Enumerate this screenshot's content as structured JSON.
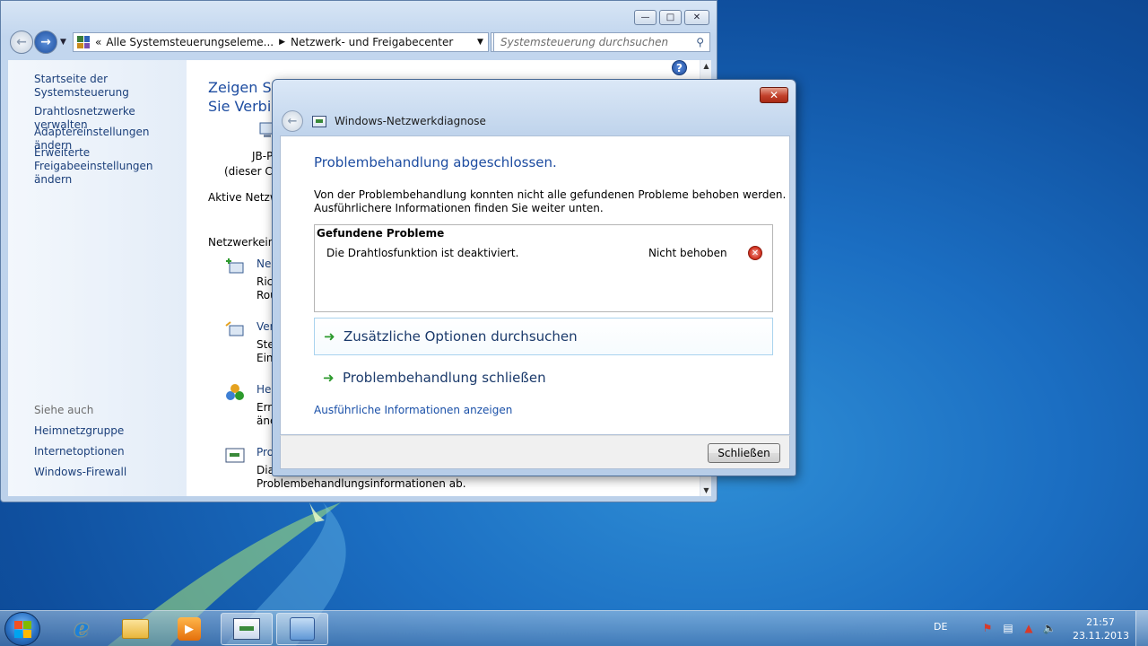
{
  "control_panel": {
    "breadcrumb": {
      "overflow": "«",
      "item1": "Alle Systemsteuerungseleme...",
      "item2": "Netzwerk- und Freigabecenter"
    },
    "search_placeholder": "Systemsteuerung durchsuchen",
    "sidebar": {
      "home": "Startseite der Systemsteuerung",
      "links": [
        "Drahtlosnetzwerke verwalten",
        "Adaptereinstellungen ändern",
        "Erweiterte",
        "Freigabeeinstellungen ändern"
      ],
      "see_also_heading": "Siehe auch",
      "see_also": [
        "Heimnetzgruppe",
        "Internetoptionen",
        "Windows-Firewall"
      ]
    },
    "main": {
      "title_line1": "Zeigen Sie",
      "title_line2": "Sie Verbin",
      "computer_name": "JB-P",
      "computer_sub": "(dieser Co",
      "active_networks": "Aktive Netzw",
      "settings_heading": "Netzwerkeinst",
      "tasks": [
        {
          "title": "Neu",
          "line1": "Rich",
          "line2": "Rou"
        },
        {
          "title": "Ver",
          "line1": "Stel",
          "line2": "Einv"
        },
        {
          "title": "Hei",
          "line1": "Erm",
          "line2": "änc"
        },
        {
          "title": "Pro",
          "line1": "Dia",
          "line2": "Problembehandlungsinformationen ab."
        }
      ]
    },
    "help": "?"
  },
  "dialog": {
    "title": "Windows-Netzwerkdiagnose",
    "heading": "Problembehandlung abgeschlossen.",
    "description_line1": "Von der Problembehandlung konnten nicht alle gefundenen Probleme behoben werden.",
    "description_line2": "Ausführlichere Informationen finden Sie weiter unten.",
    "problems_heading": "Gefundene Probleme",
    "problems": [
      {
        "name": "Die Drahtlosfunktion ist deaktiviert.",
        "status": "Nicht behoben",
        "status_icon": "error-icon"
      }
    ],
    "option_more": "Zusätzliche Optionen durchsuchen",
    "option_close": "Problembehandlung schließen",
    "details_link": "Ausführliche Informationen anzeigen",
    "close_button": "Schließen"
  },
  "taskbar": {
    "language": "DE",
    "time": "21:57",
    "date": "23.11.2013"
  },
  "colors": {
    "link_blue": "#1b3f7a",
    "heading_blue": "#1e4da1",
    "error_red": "#d1301f",
    "arrow_green": "#2d9a2d"
  }
}
